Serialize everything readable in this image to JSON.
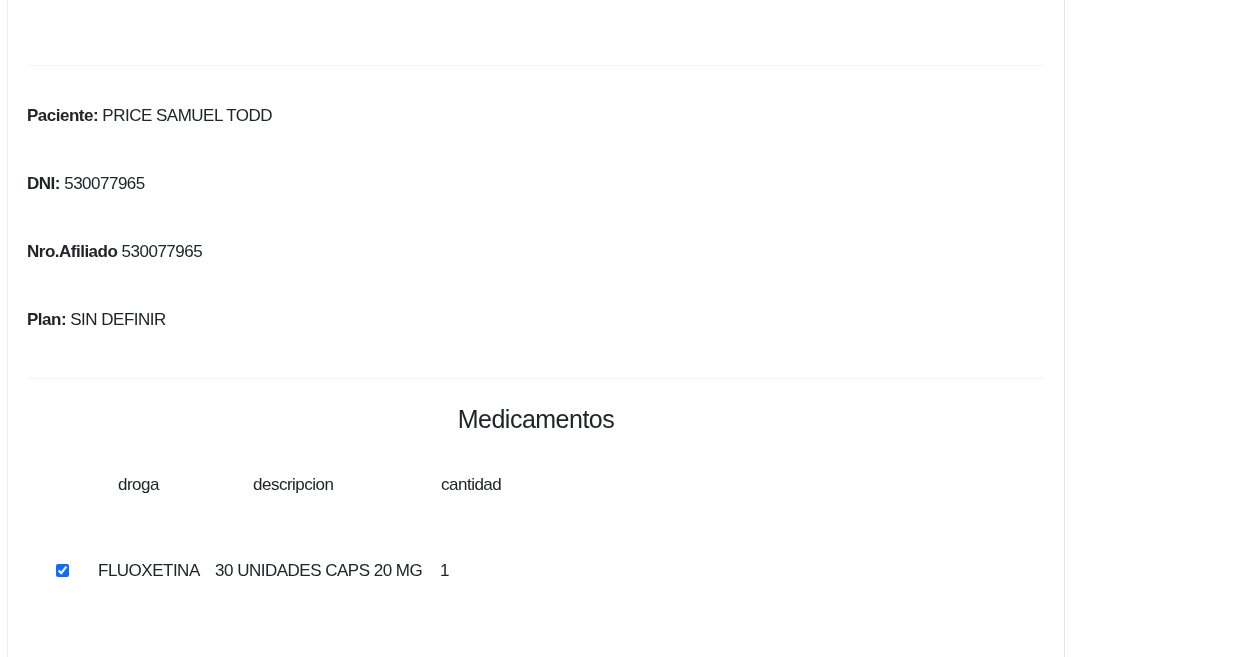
{
  "patient_fields": [
    {
      "label": "Paciente:",
      "value": "PRICE SAMUEL TODD"
    },
    {
      "label": "DNI:",
      "value": "530077965"
    },
    {
      "label": "Nro.Afiliado",
      "value": "530077965"
    },
    {
      "label": "Plan:",
      "value": "SIN DEFINIR"
    }
  ],
  "medications": {
    "title": "Medicamentos",
    "columns": [
      "droga",
      "descripcion",
      "cantidad"
    ],
    "rows": [
      {
        "checked": true,
        "cells": [
          "FLUOXETINA",
          "30 UNIDADES CAPS 20 MG",
          "1"
        ]
      }
    ]
  }
}
